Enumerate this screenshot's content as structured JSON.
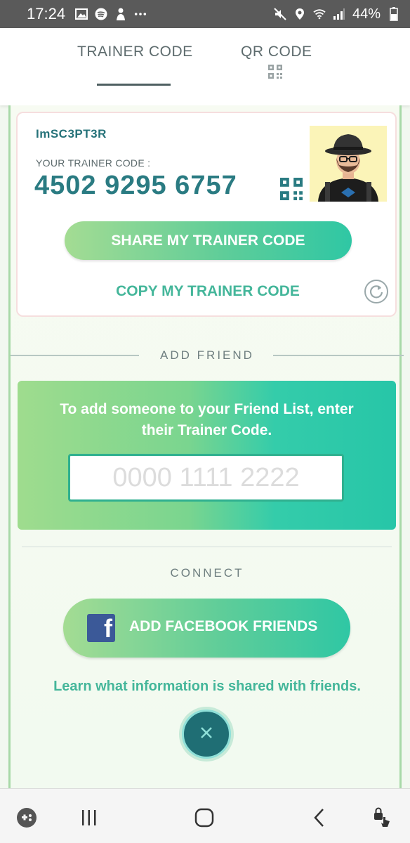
{
  "status_bar": {
    "time": "17:24",
    "battery": "44%",
    "icons_left": [
      "gallery-icon",
      "spotify-icon",
      "pokemon-go-icon",
      "more-icon"
    ],
    "icons_right": [
      "mute-icon",
      "location-icon",
      "wifi-icon",
      "signal-icon",
      "battery-icon"
    ]
  },
  "tabs": [
    {
      "label": "TRAINER CODE",
      "active": true
    },
    {
      "label": "QR CODE",
      "active": false
    }
  ],
  "trainer_card": {
    "name": "ImSC3PT3R",
    "code_label": "YOUR TRAINER CODE :",
    "code": "4502 9295 6757",
    "share_label": "SHARE MY TRAINER CODE",
    "copy_label": "COPY MY TRAINER CODE"
  },
  "add_friend": {
    "title": "ADD FRIEND",
    "instructions": "To add someone to your Friend List, enter their Trainer Code.",
    "placeholder": "0000 1111 2222"
  },
  "connect": {
    "title": "CONNECT",
    "facebook_label": "ADD FACEBOOK FRIENDS",
    "learn_label": "Learn what information is shared with friends."
  },
  "colors": {
    "accent": "#2a7b82",
    "teal": "#44b69a",
    "button_start": "#a4dc93",
    "button_end": "#2fc7a4",
    "facebook": "#3b5998"
  },
  "nav_bar": {
    "items": [
      "game-launcher-icon",
      "recent-apps-icon",
      "home-icon",
      "back-icon",
      "touch-lock-icon"
    ]
  }
}
